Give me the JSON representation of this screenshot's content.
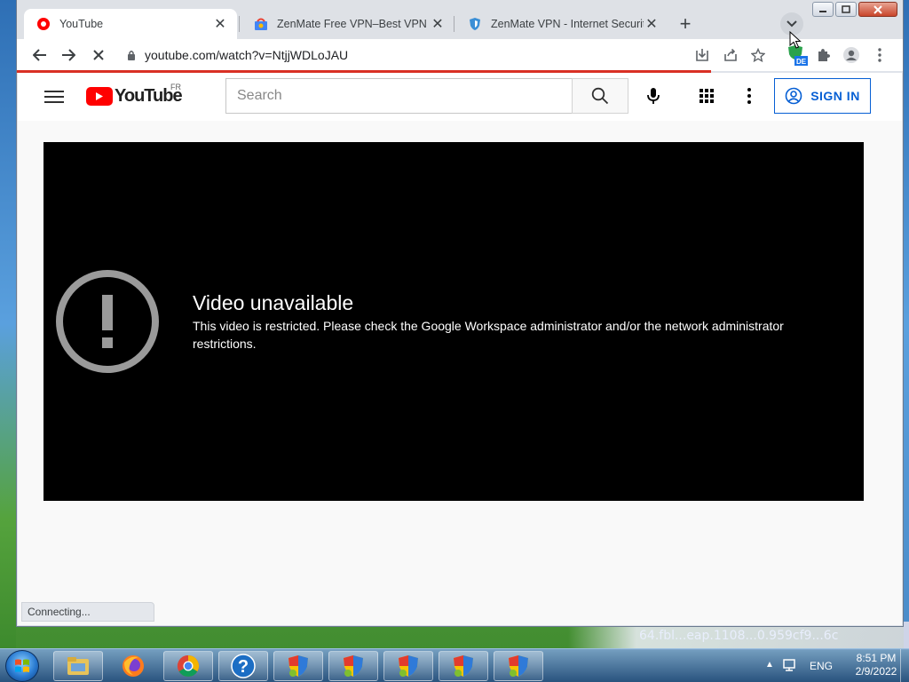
{
  "desktop": {
    "bg_text": "64.fbl...eap.1108...0.959cf9...6c"
  },
  "tabs": [
    {
      "title": "YouTube",
      "icon": "youtube-favicon",
      "active": true
    },
    {
      "title": "ZenMate Free VPN–Best VPN for",
      "icon": "zenmate-store-favicon",
      "active": false
    },
    {
      "title": "ZenMate VPN - Internet Security",
      "icon": "zenmate-shield-favicon",
      "active": false
    }
  ],
  "tab_close_glyph": "✕",
  "new_tab_glyph": "+",
  "toolbar": {
    "url": "youtube.com/watch?v=NtjjWDLoJAU",
    "extension_badge": "DE"
  },
  "youtube": {
    "logo_text": "YouTube",
    "country_code": "FR",
    "search_placeholder": "Search",
    "sign_in_label": "SIGN IN",
    "error_title": "Video unavailable",
    "error_message": "This video is restricted. Please check the Google Workspace administrator and/or the network administrator restrictions."
  },
  "status": {
    "text": "Connecting..."
  },
  "taskbar": {
    "language": "ENG",
    "time": "8:51 PM",
    "date": "2/9/2022"
  },
  "colors": {
    "yt_red": "#ff0000",
    "sign_in_blue": "#065fd4",
    "load_bar": "#d93025"
  }
}
